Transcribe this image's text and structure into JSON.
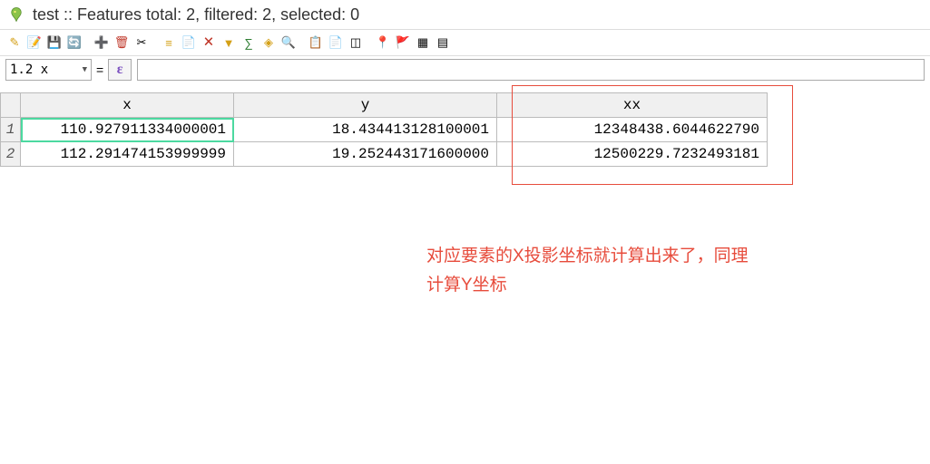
{
  "title": "test :: Features total: 2, filtered: 2, selected: 0",
  "field_selector": "1.2 x",
  "epsilon": "ε",
  "expression": "",
  "columns": [
    "x",
    "y",
    "xx"
  ],
  "rows": [
    {
      "n": "1",
      "x": "110.927911334000001",
      "y": "18.434413128100001",
      "xx": "12348438.6044622790"
    },
    {
      "n": "2",
      "x": "112.291474153999999",
      "y": "19.252443171600000",
      "xx": "12500229.7232493181"
    }
  ],
  "annotation": "对应要素的X投影坐标就计算出来了，同理\n计算Y坐标",
  "icons": {
    "pencil": "✎",
    "edit": "📝",
    "save": "💾",
    "refresh": "🔄",
    "add": "➕",
    "trash": "🗑",
    "cutcol": "✂",
    "eqpanel": "≡",
    "newcol": "📄",
    "delcol": "🗙",
    "funnel": "▼",
    "calc": "∑",
    "diamonds": "◈",
    "search": "🔍",
    "copy": "📋",
    "paste": "📄",
    "multi": "◫",
    "pin": "📍",
    "flag": "🚩",
    "grid": "▦",
    "panel": "▤"
  }
}
